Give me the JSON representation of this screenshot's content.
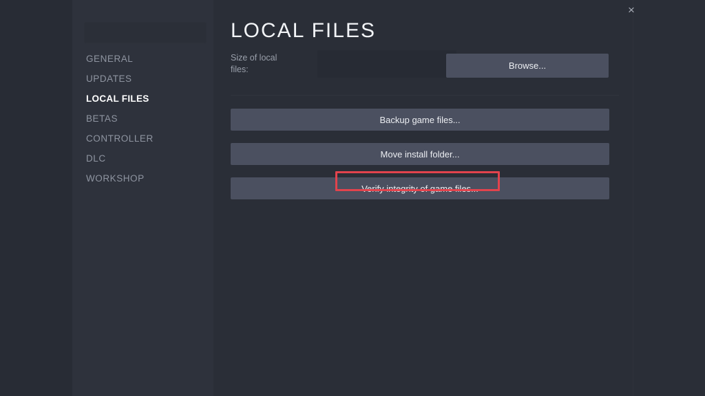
{
  "window": {
    "close_icon": "×"
  },
  "sidebar": {
    "search_placeholder": "",
    "items": [
      {
        "label": "GENERAL",
        "active": false
      },
      {
        "label": "UPDATES",
        "active": false
      },
      {
        "label": "LOCAL FILES",
        "active": true
      },
      {
        "label": "BETAS",
        "active": false
      },
      {
        "label": "CONTROLLER",
        "active": false
      },
      {
        "label": "DLC",
        "active": false
      },
      {
        "label": "WORKSHOP",
        "active": false
      }
    ]
  },
  "main": {
    "title": "LOCAL FILES",
    "size_row": {
      "label": "Size of local files:",
      "value": "",
      "browse_label": "Browse..."
    },
    "actions": [
      {
        "label": "Backup game files...",
        "highlighted": false
      },
      {
        "label": "Move install folder...",
        "highlighted": false
      },
      {
        "label": "Verify integrity of game files...",
        "highlighted": true
      }
    ]
  },
  "annotation": {
    "target_label": "Verify integrity of game files...",
    "color": "#e2434d"
  },
  "colors": {
    "gutter": "#282c35",
    "sidebar": "#2e323c",
    "panel": "#2a2e37",
    "button": "#4b5060",
    "field": "#272b34",
    "text_primary": "#f2f4f7",
    "text_muted": "#8f95a1",
    "accent_red": "#e2434d"
  }
}
